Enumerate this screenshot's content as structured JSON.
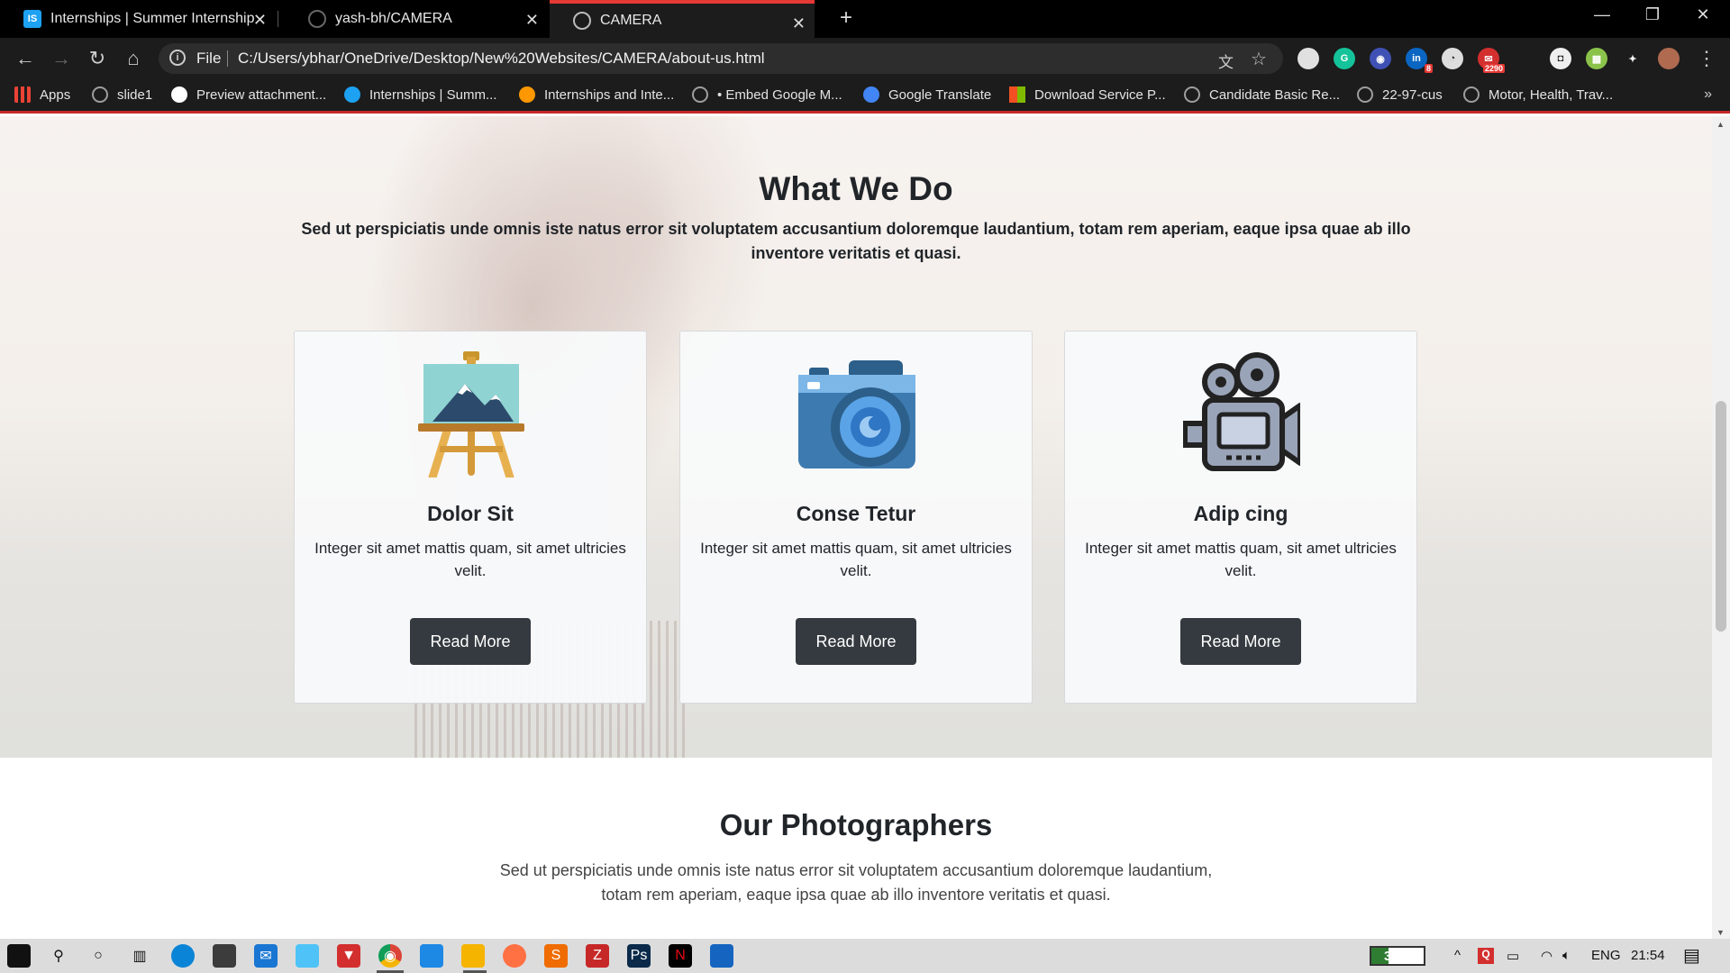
{
  "browser": {
    "tabs": [
      {
        "title": "Internships | Summer Internship",
        "favicon": "is-logo-icon",
        "active": false
      },
      {
        "title": "yash-bh/CAMERA",
        "favicon": "github-icon",
        "active": false
      },
      {
        "title": "CAMERA",
        "favicon": "globe-icon",
        "active": true
      }
    ],
    "tab_close_glyph": "✕",
    "new_tab_glyph": "+",
    "window_controls": {
      "minimize": "—",
      "restore": "❐",
      "close": "✕"
    },
    "nav": {
      "back": "←",
      "forward": "→",
      "reload": "↻",
      "home": "⌂"
    },
    "address": {
      "scheme_label": "File",
      "url": "C:/Users/ybhar/OneDrive/Desktop/New%20Websites/CAMERA/about-us.html"
    },
    "omnibox_icons": {
      "translate": "文",
      "bookmark_star": "☆"
    },
    "extensions": [
      {
        "name": "circle-extension-icon",
        "label": "",
        "color": "#e0e0e0",
        "badge": ""
      },
      {
        "name": "grammarly-icon",
        "label": "G",
        "color": "#15c39a",
        "badge": ""
      },
      {
        "name": "owl-extension-icon",
        "label": "◉",
        "color": "#3f51b5",
        "badge": ""
      },
      {
        "name": "linkedin-icon",
        "label": "in",
        "color": "#0a66c2",
        "badge": "8"
      },
      {
        "name": "speed-extension-icon",
        "label": "◔",
        "color": "#dddddd",
        "badge": ""
      },
      {
        "name": "mail-extension-icon",
        "label": "✉",
        "color": "#d32f2f",
        "badge": "2290"
      },
      {
        "name": "instagram-icon",
        "label": "◘",
        "color": "#eeeeee",
        "badge": ""
      },
      {
        "name": "color-extension-icon",
        "label": "▦",
        "color": "#8bc34a",
        "badge": ""
      },
      {
        "name": "puzzle-icon",
        "label": "✦",
        "color": "#1c1c1c",
        "badge": ""
      },
      {
        "name": "profile-avatar",
        "label": "",
        "color": "#b06a50",
        "badge": ""
      }
    ],
    "menu_glyph": "⋮",
    "bookmarks": [
      {
        "label": "Apps",
        "icon": "apps-grid-icon",
        "color": "#ea4335"
      },
      {
        "label": "slide1",
        "icon": "globe-icon",
        "color": "#9e9e9e"
      },
      {
        "label": "Preview attachment...",
        "icon": "google-icon",
        "color": "#ffffff"
      },
      {
        "label": "Internships | Summ...",
        "icon": "is-logo-icon",
        "color": "#1da1f2"
      },
      {
        "label": "Internships and Inte...",
        "icon": "fire-icon",
        "color": "#ff9800"
      },
      {
        "label": "• Embed Google M...",
        "icon": "globe-icon",
        "color": "#9e9e9e"
      },
      {
        "label": "Google Translate",
        "icon": "translate-icon",
        "color": "#4285f4"
      },
      {
        "label": "Download Service P...",
        "icon": "microsoft-icon",
        "color": "#f25022"
      },
      {
        "label": "Candidate Basic Re...",
        "icon": "globe-icon",
        "color": "#9e9e9e"
      },
      {
        "label": "22-97-cus",
        "icon": "globe-icon",
        "color": "#9e9e9e"
      },
      {
        "label": "Motor, Health, Trav...",
        "icon": "globe-icon",
        "color": "#9e9e9e"
      }
    ],
    "bookmarks_more": "»"
  },
  "page": {
    "what_we_do": {
      "title": "What We Do",
      "lead": "Sed ut perspiciatis unde omnis iste natus error sit voluptatem accusantium doloremque laudantium, totam rem aperiam, eaque ipsa quae ab illo inventore veritatis et quasi."
    },
    "cards": [
      {
        "title": "Dolor Sit",
        "text": "Integer sit amet mattis quam, sit amet ultricies velit.",
        "button": "Read More",
        "icon": "easel-painting-icon"
      },
      {
        "title": "Conse Tetur",
        "text": "Integer sit amet mattis quam, sit amet ultricies velit.",
        "button": "Read More",
        "icon": "camera-icon"
      },
      {
        "title": "Adip cing",
        "text": "Integer sit amet mattis quam, sit amet ultricies velit.",
        "button": "Read More",
        "icon": "movie-camera-icon"
      }
    ],
    "photographers": {
      "title": "Our Photographers",
      "lead": "Sed ut perspiciatis unde omnis iste natus error sit voluptatem accusantium doloremque laudantium, totam rem aperiam, eaque ipsa quae ab illo inventore veritatis et quasi."
    }
  },
  "taskbar": {
    "apps": [
      "start-windows-icon",
      "search-icon",
      "cortana-icon",
      "task-view-icon",
      "edge-icon",
      "store-icon",
      "mail-icon",
      "folder-3d-icon",
      "download-app-icon",
      "chrome-icon",
      "vscode-icon",
      "file-explorer-icon",
      "firefox-icon",
      "sublime-icon",
      "filezilla-icon",
      "photoshop-icon",
      "netflix-icon",
      "photos-icon"
    ],
    "battery_percent": 32,
    "battery_label": "32%",
    "tray": {
      "chevron": "^",
      "language": "ENG",
      "time": "21:54"
    }
  },
  "colors": {
    "button_dark": "#343a40",
    "active_tab_accent": "#e53935",
    "card_bg": "#f8f9fa"
  }
}
